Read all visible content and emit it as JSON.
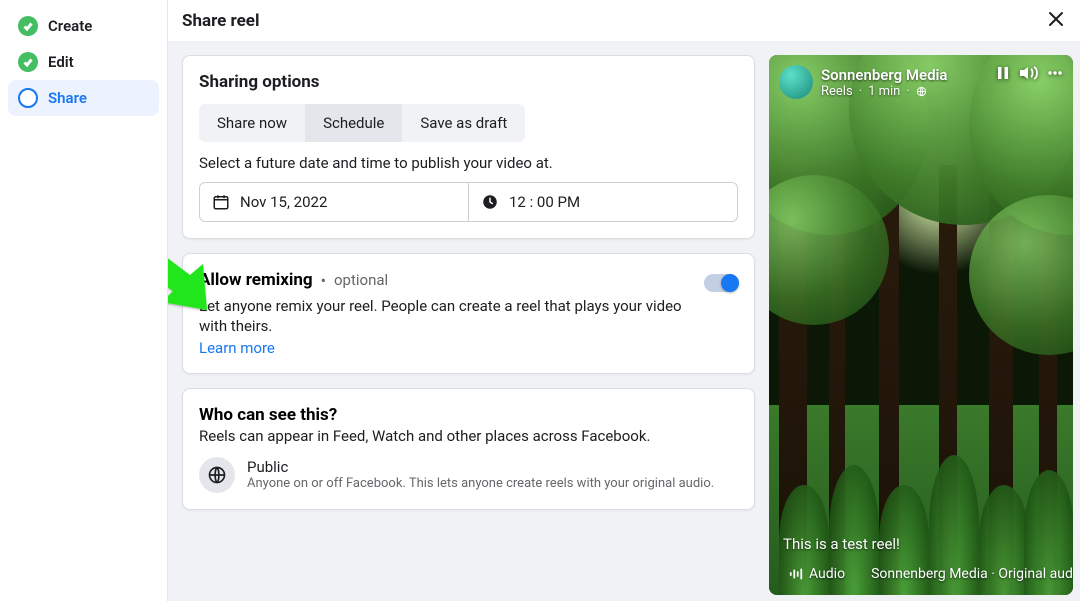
{
  "sidebar": {
    "steps": [
      {
        "label": "Create",
        "status": "done"
      },
      {
        "label": "Edit",
        "status": "done"
      },
      {
        "label": "Share",
        "status": "current"
      }
    ]
  },
  "header": {
    "title": "Share reel"
  },
  "sharing": {
    "title": "Sharing options",
    "tabs": {
      "now": "Share now",
      "schedule": "Schedule",
      "draft": "Save as draft"
    },
    "hint": "Select a future date and time to publish your video at.",
    "date_value": "Nov 15, 2022",
    "time_value": "12 : 00 PM"
  },
  "remix": {
    "title": "Allow remixing",
    "optional": "optional",
    "desc": "Let anyone remix your reel. People can create a reel that plays your video with theirs.",
    "learn_more": "Learn more"
  },
  "audience": {
    "title": "Who can see this?",
    "sub": "Reels can appear in Feed, Watch and other places across Facebook.",
    "option_name": "Public",
    "option_desc": "Anyone on or off Facebook. This lets anyone create reels with your original audio."
  },
  "preview": {
    "account_name": "Sonnenberg Media",
    "surface": "Reels",
    "time_ago": "1 min",
    "caption": "This is a test reel!",
    "audio_label": "Audio",
    "audio_source": "Sonnenberg Media · Original aud"
  }
}
